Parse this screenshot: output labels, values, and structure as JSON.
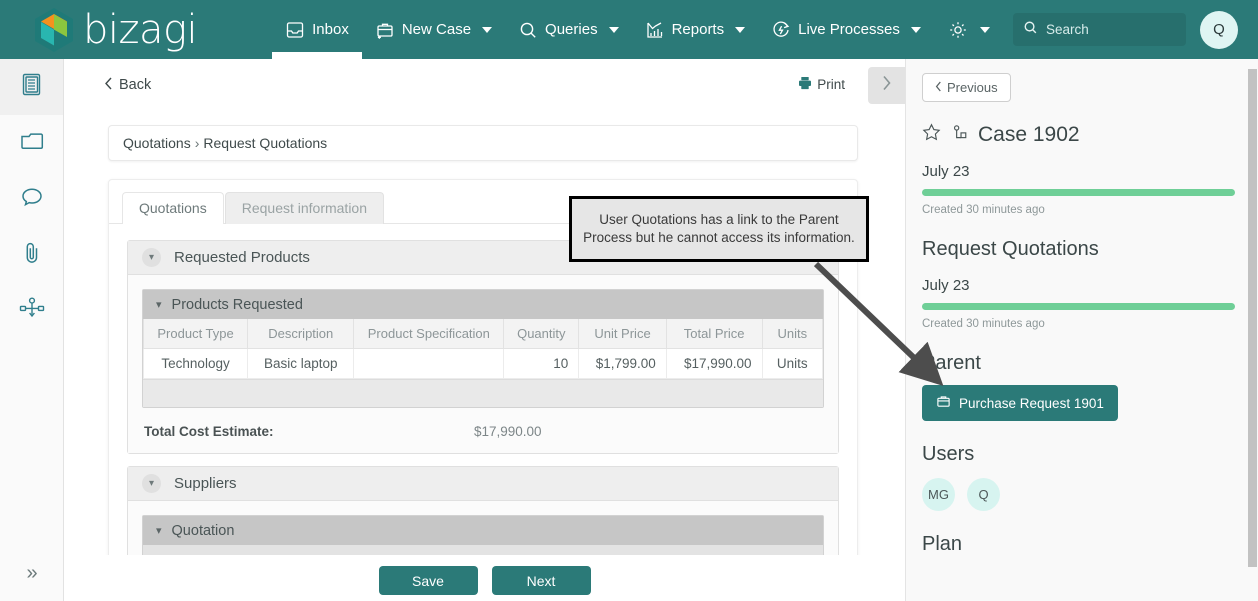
{
  "brand": {
    "name": "bizagi",
    "primary_color": "#2b7a78",
    "logo_colors": [
      "#f6911e",
      "#8cc63f",
      "#29b6b0",
      "#1f7a78"
    ]
  },
  "topnav": {
    "items": [
      {
        "label": "Inbox",
        "icon": "inbox-icon",
        "active": true,
        "has_caret": false
      },
      {
        "label": "New Case",
        "icon": "briefcase-plus-icon",
        "active": false,
        "has_caret": true
      },
      {
        "label": "Queries",
        "icon": "search-icon",
        "active": false,
        "has_caret": true
      },
      {
        "label": "Reports",
        "icon": "chart-icon",
        "active": false,
        "has_caret": true
      },
      {
        "label": "Live Processes",
        "icon": "live-processes-icon",
        "active": false,
        "has_caret": true
      },
      {
        "label": "",
        "icon": "gear-icon",
        "active": false,
        "has_caret": true
      }
    ],
    "search": {
      "placeholder": "Search",
      "value": "",
      "icon": "search-icon"
    },
    "avatar": {
      "initials": "Q"
    }
  },
  "rail": {
    "items": [
      {
        "name": "sidebar-item-activities",
        "icon": "list-document-icon",
        "selected": true
      },
      {
        "name": "sidebar-item-folder",
        "icon": "folder-icon",
        "selected": false
      },
      {
        "name": "sidebar-item-comments",
        "icon": "comment-icon",
        "selected": false
      },
      {
        "name": "sidebar-item-attachments",
        "icon": "paperclip-icon",
        "selected": false
      },
      {
        "name": "sidebar-item-process",
        "icon": "process-diagram-icon",
        "selected": false
      }
    ],
    "expand_label": "»"
  },
  "toolbar": {
    "back_label": "Back",
    "print_label": "Print",
    "next_pane_icon": "chevron-right-icon"
  },
  "breadcrumb": {
    "root": "Quotations",
    "separator": "›",
    "current": "Request Quotations"
  },
  "form": {
    "tabs": [
      {
        "label": "Quotations",
        "active": true
      },
      {
        "label": "Request information",
        "active": false
      }
    ],
    "sections": [
      {
        "title": "Requested Products",
        "subsection_title": "Products Requested",
        "table": {
          "columns": [
            "Product Type",
            "Description",
            "Product Specification",
            "Quantity",
            "Unit Price",
            "Total Price",
            "Units"
          ],
          "rows": [
            [
              "Technology",
              "Basic laptop",
              "",
              "10",
              "$1,799.00",
              "$17,990.00",
              "Units"
            ]
          ]
        },
        "total_label": "Total Cost Estimate:",
        "total_value": "$17,990.00"
      },
      {
        "title": "Suppliers",
        "subsection_title": "Quotation"
      }
    ]
  },
  "footer": {
    "save_label": "Save",
    "next_label": "Next"
  },
  "side": {
    "previous_label": "Previous",
    "favorite_icon": "star-icon",
    "relations_icon": "case-relations-icon",
    "case_title": "Case 1902",
    "case_date": "July 23",
    "case_created": "Created 30 minutes ago",
    "activity_title": "Request Quotations",
    "activity_date": "July 23",
    "activity_created": "Created 30 minutes ago",
    "parent_heading": "Parent",
    "parent_button": {
      "label": "Purchase Request 1901",
      "icon": "briefcase-icon"
    },
    "users_heading": "Users",
    "users": [
      {
        "initials": "MG"
      },
      {
        "initials": "Q"
      }
    ],
    "plan_heading": "Plan",
    "progress_color": "#6fcf97"
  },
  "annotation": {
    "text": "User Quotations has a link to the Parent Process but he cannot access its information.",
    "arrow": "points-to-parent-button"
  }
}
